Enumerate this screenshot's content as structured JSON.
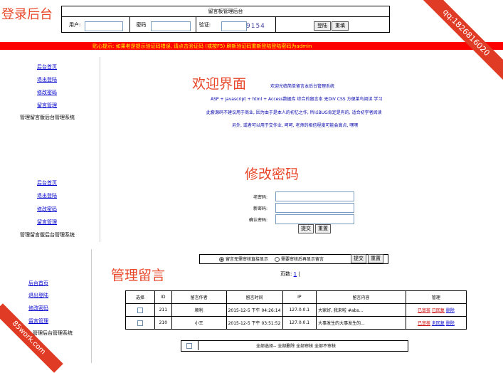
{
  "header": {
    "title": "登录后台",
    "login_box_title": "留言板管理后台",
    "user_label": "用户:",
    "password_label": "密码",
    "captcha_label": "验证:",
    "captcha_code": "9154",
    "login_button": "登陆",
    "reset_button": "重填"
  },
  "notice": "贴心提示: 如果老是提示验证码错误, 请点击验证码 (或按F5) 刷新验证码重新登陆登陆密码为admin",
  "sidebar_1": {
    "links": [
      "后台首页",
      "退出登陆",
      "修改密码",
      "留言管理"
    ],
    "caption": "管理留言版后台管理系统"
  },
  "sidebar_2": {
    "links": [
      "后台首页",
      "退出登陆",
      "修改密码",
      "留言管理"
    ],
    "caption": "管理留言版后台管理系统"
  },
  "sidebar_3": {
    "links": [
      "后台首页",
      "退出登陆",
      "修改密码",
      "留言管理"
    ],
    "caption": "管理后台管理系统"
  },
  "welcome": {
    "title": "欢迎界面",
    "subtitle": "欢迎光临简单留言本后台管理系统",
    "line1": "ASP + javascript + html + Access数据库 综合的留言本 无DIV CSS 方便莱鸟阅读 学习",
    "line2": "此套源码不建议用于商业, 因为由于是本人的初忆之作, 所以BUG肯定是有的, 适合初学者阅读",
    "line3": "另外, 或者可以用于交作业, 呵呵, 老师的相信程度可能会高点, 嘿嘿"
  },
  "change_password": {
    "title": "修改密码",
    "old_label": "老密码:",
    "new_label": "新密码:",
    "confirm_label": "确认密码:",
    "submit_button": "提交",
    "reset_button": "重置"
  },
  "manage": {
    "title": "管理留言",
    "option_no_review": "留言无需审核直接显示",
    "option_review": "需要审核后再显示留言",
    "submit_button": "提交",
    "reset_button": "重置",
    "pages_label": "页数:",
    "page_current": "1",
    "page_sep": "|",
    "table": {
      "headers": [
        "选择",
        "ID",
        "留言作者",
        "留言时间",
        "IP",
        "留言内容",
        "管理"
      ],
      "rows": [
        {
          "id": "211",
          "author": "顺利",
          "time": "2015-12-5 下午 04:26:14",
          "ip": "127.0.0.1",
          "content": "大家好, 我来啦 #abs...",
          "action1": "已审核",
          "action2": "已回复",
          "action3": "删除"
        },
        {
          "id": "210",
          "author": "小王",
          "time": "2015-12-5 下午 03:51:52",
          "ip": "127.0.0.1",
          "content": "大事发生的大事发生的...",
          "action1": "已审核",
          "action2": "未回复",
          "action3": "删除"
        }
      ]
    },
    "bulk_actions": "全部选择-- 全部删除 全部审核 全部不审核"
  },
  "watermarks": {
    "qq": "qq:1826816020",
    "site": "85work.com"
  },
  "colors": {
    "accent_red": "#e8472a",
    "notice_bar": "#ff0000",
    "notice_text": "#ffff00",
    "watermark": "#e03b24",
    "link": "#0000cc"
  }
}
